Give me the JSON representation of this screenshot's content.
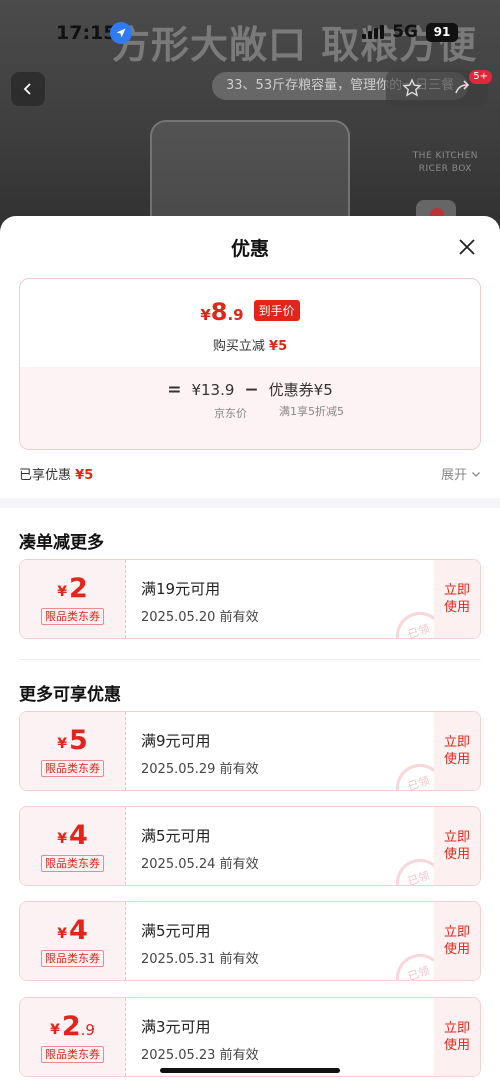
{
  "status_bar": {
    "time": "17:15",
    "network": "5G",
    "battery": "91"
  },
  "background": {
    "headline": "方形大敞口 取粮方便",
    "subline": "33、53斤存粮容量，管理你的一日三餐",
    "share_badge": "5+",
    "brand_line1": "THE KITCHEN",
    "brand_line2": "RICER BOX"
  },
  "sheet": {
    "title": "优惠"
  },
  "price_card": {
    "yen": "¥",
    "final_int": "8",
    "final_dec": ".9",
    "final_tag": "到手价",
    "instant_label": "购买立减",
    "instant_amount": "¥5",
    "eq": "=",
    "jd_price": "¥13.9",
    "minus": "−",
    "coupon_label": "优惠券¥5",
    "jd_price_label": "京东价",
    "coupon_desc": "满1享5折减5"
  },
  "enjoyed": {
    "label": "已享优惠",
    "amount": "¥5",
    "expand": "展开"
  },
  "sections": {
    "more_orders": "凑单减更多",
    "more_discounts": "更多可享优惠"
  },
  "coupons": [
    {
      "yen": "¥",
      "amount": "2",
      "dec": "",
      "type": "限品类东券",
      "condition": "满19元可用",
      "expiry": "2025.05.20 前有效",
      "action": "立即使用",
      "stamp": "已领"
    },
    {
      "yen": "¥",
      "amount": "5",
      "dec": "",
      "type": "限品类东券",
      "condition": "满9元可用",
      "expiry": "2025.05.29 前有效",
      "action": "立即使用",
      "stamp": "已领"
    },
    {
      "yen": "¥",
      "amount": "4",
      "dec": "",
      "type": "限品类东券",
      "condition": "满5元可用",
      "expiry": "2025.05.24 前有效",
      "action": "立即使用",
      "stamp": "已领"
    },
    {
      "yen": "¥",
      "amount": "4",
      "dec": "",
      "type": "限品类东券",
      "condition": "满5元可用",
      "expiry": "2025.05.31 前有效",
      "action": "立即使用",
      "stamp": "已领"
    },
    {
      "yen": "¥",
      "amount": "2",
      "dec": ".9",
      "type": "限品类东券",
      "condition": "满3元可用",
      "expiry": "2025.05.23 前有效",
      "action": "立即使用",
      "stamp": ""
    }
  ],
  "colors": {
    "accent": "#e1251b",
    "coupon_bg": "#fdf2f3"
  },
  "icons": [
    "location-arrow-icon",
    "back-chevron-icon",
    "star-icon",
    "share-icon",
    "close-icon",
    "chevron-down-icon"
  ]
}
